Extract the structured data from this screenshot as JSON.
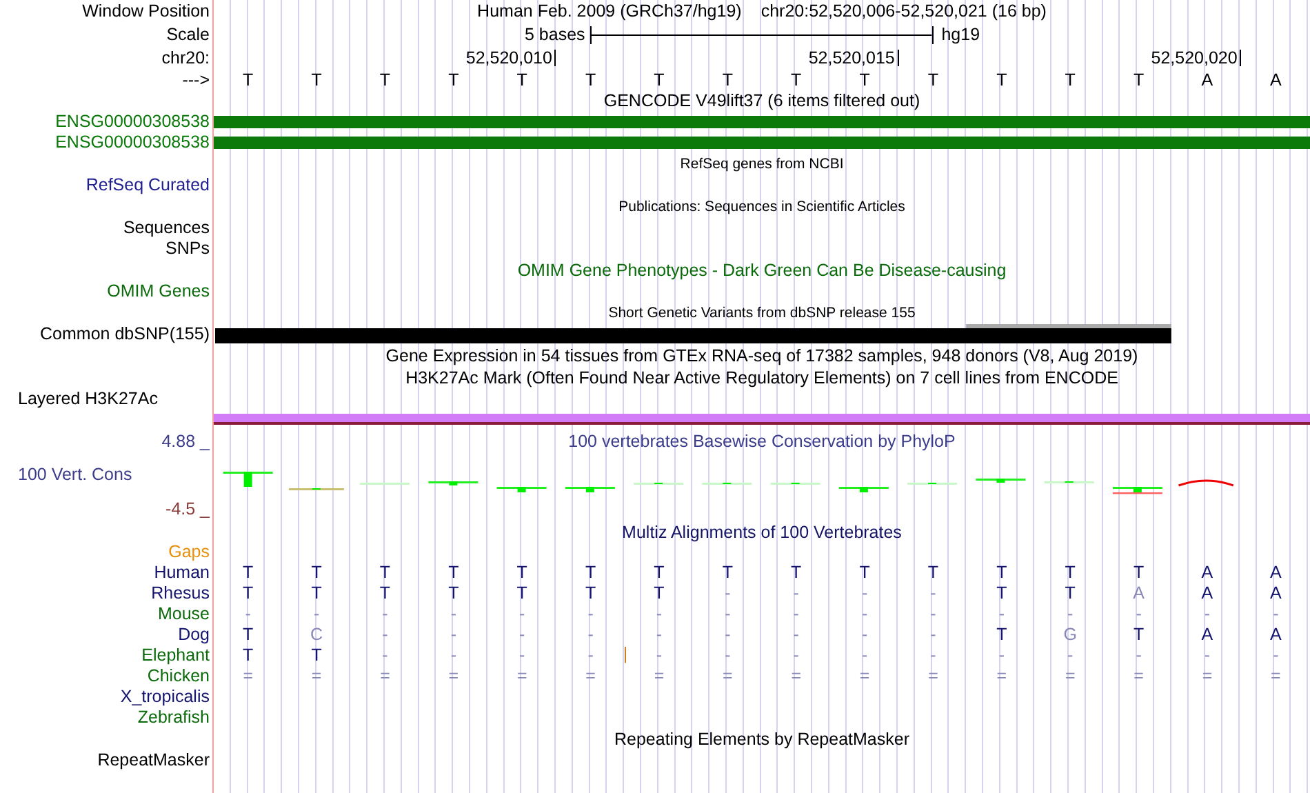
{
  "header": {
    "window_position": {
      "label": "Window Position",
      "assembly": "Human Feb. 2009 (GRCh37/hg19)",
      "range": "chr20:52,520,006-52,520,021 (16 bp)"
    },
    "scale": {
      "label": "Scale",
      "length": "5 bases",
      "assembly": "hg19"
    },
    "ruler": {
      "label": "chr20:",
      "ticks": [
        "52,520,010",
        "52,520,015",
        "52,520,020"
      ]
    },
    "sequence": {
      "label": "--->",
      "bases": [
        "T",
        "T",
        "T",
        "T",
        "T",
        "T",
        "T",
        "T",
        "T",
        "T",
        "T",
        "T",
        "T",
        "T",
        "A",
        "A"
      ]
    }
  },
  "tracks": [
    {
      "kind": "genes",
      "title": "GENCODE V49lift37 (6 items filtered out)",
      "items": [
        {
          "label": "ENSG00000308538",
          "color": "#0b7a0b"
        },
        {
          "label": "ENSG00000308538",
          "color": "#0b7a0b"
        }
      ]
    },
    {
      "kind": "empty",
      "title": "RefSeq genes from NCBI",
      "labels": [
        {
          "text": "RefSeq Curated",
          "color": "#202090"
        }
      ]
    },
    {
      "kind": "empty",
      "title": "Publications: Sequences in Scientific Articles",
      "labels": [
        {
          "text": "Sequences",
          "color": "#000000"
        },
        {
          "text": "SNPs",
          "color": "#000000"
        }
      ]
    },
    {
      "kind": "named",
      "title": "OMIM Gene Phenotypes - Dark Green Can Be Disease-causing",
      "color": "#0b6b0b",
      "labels": [
        {
          "text": "OMIM Genes",
          "color": "#0b6b0b"
        }
      ]
    },
    {
      "kind": "variants",
      "title": "Short Genetic Variants from dbSNP release 155",
      "label": "Common dbSNP(155)"
    },
    {
      "kind": "title",
      "title": "Gene Expression in 54 tissues from GTEx RNA-seq of 17382 samples, 948 donors (V8, Aug 2019)"
    },
    {
      "kind": "signal",
      "title": "H3K27Ac Mark (Often Found Near Active Regulatory Elements) on 7 cell lines from ENCODE",
      "label": "Layered H3K27Ac"
    },
    {
      "kind": "wiggle",
      "title": "100 vertebrates Basewise Conservation by PhyloP",
      "label": "100 Vert. Cons",
      "max": "4.88 _",
      "min": "-4.5 _",
      "color": "#3c3c8c"
    },
    {
      "kind": "alignment",
      "title": "Multiz Alignments of 100 Vertebrates",
      "color": "#141464",
      "species": [
        {
          "name": "Gaps",
          "color": "#e8900c"
        },
        {
          "name": "Human",
          "color": "#14146e",
          "bases": [
            {
              "b": "T",
              "match": true
            },
            {
              "b": "T",
              "match": true
            },
            {
              "b": "T",
              "match": true
            },
            {
              "b": "T",
              "match": true
            },
            {
              "b": "T",
              "match": true
            },
            {
              "b": "T",
              "match": true
            },
            {
              "b": "T",
              "match": true
            },
            {
              "b": "T",
              "match": true
            },
            {
              "b": "T",
              "match": true
            },
            {
              "b": "T",
              "match": true
            },
            {
              "b": "T",
              "match": true
            },
            {
              "b": "T",
              "match": true
            },
            {
              "b": "T",
              "match": true
            },
            {
              "b": "T",
              "match": true
            },
            {
              "b": "A",
              "match": true
            },
            {
              "b": "A",
              "match": true
            }
          ]
        },
        {
          "name": "Rhesus",
          "color": "#14146e",
          "bases": [
            {
              "b": "T",
              "match": true
            },
            {
              "b": "T",
              "match": true
            },
            {
              "b": "T",
              "match": true
            },
            {
              "b": "T",
              "match": true
            },
            {
              "b": "T",
              "match": true
            },
            {
              "b": "T",
              "match": true
            },
            {
              "b": "T",
              "match": true
            },
            {
              "b": "-",
              "match": false
            },
            {
              "b": "-",
              "match": false
            },
            {
              "b": "-",
              "match": false
            },
            {
              "b": "-",
              "match": false
            },
            {
              "b": "T",
              "match": true
            },
            {
              "b": "T",
              "match": true
            },
            {
              "b": "A",
              "match": false
            },
            {
              "b": "A",
              "match": true
            },
            {
              "b": "A",
              "match": true
            }
          ]
        },
        {
          "name": "Mouse",
          "color": "#0b6b0b",
          "bases": [
            {
              "b": "-",
              "match": false
            },
            {
              "b": "-",
              "match": false
            },
            {
              "b": "-",
              "match": false
            },
            {
              "b": "-",
              "match": false
            },
            {
              "b": "-",
              "match": false
            },
            {
              "b": "-",
              "match": false
            },
            {
              "b": "-",
              "match": false
            },
            {
              "b": "-",
              "match": false
            },
            {
              "b": "-",
              "match": false
            },
            {
              "b": "-",
              "match": false
            },
            {
              "b": "-",
              "match": false
            },
            {
              "b": "-",
              "match": false
            },
            {
              "b": "-",
              "match": false
            },
            {
              "b": "-",
              "match": false
            },
            {
              "b": "-",
              "match": false
            },
            {
              "b": "-",
              "match": false
            }
          ]
        },
        {
          "name": "Dog",
          "color": "#14146e",
          "bases": [
            {
              "b": "T",
              "match": true
            },
            {
              "b": "C",
              "match": false
            },
            {
              "b": "-",
              "match": false
            },
            {
              "b": "-",
              "match": false
            },
            {
              "b": "-",
              "match": false
            },
            {
              "b": "-",
              "match": false
            },
            {
              "b": "-",
              "match": false
            },
            {
              "b": "-",
              "match": false
            },
            {
              "b": "-",
              "match": false
            },
            {
              "b": "-",
              "match": false
            },
            {
              "b": "-",
              "match": false
            },
            {
              "b": "T",
              "match": true
            },
            {
              "b": "G",
              "match": false
            },
            {
              "b": "T",
              "match": true
            },
            {
              "b": "A",
              "match": true
            },
            {
              "b": "A",
              "match": true
            }
          ]
        },
        {
          "name": "Elephant",
          "color": "#0b6b0b",
          "bases": [
            {
              "b": "T",
              "match": true
            },
            {
              "b": "T",
              "match": true
            },
            {
              "b": "-",
              "match": false
            },
            {
              "b": "-",
              "match": false
            },
            {
              "b": "-",
              "match": false
            },
            {
              "b": "-",
              "match": false,
              "insertion": "|"
            },
            {
              "b": "-",
              "match": false
            },
            {
              "b": "-",
              "match": false
            },
            {
              "b": "-",
              "match": false
            },
            {
              "b": "-",
              "match": false
            },
            {
              "b": "-",
              "match": false
            },
            {
              "b": "-",
              "match": false
            },
            {
              "b": "-",
              "match": false
            },
            {
              "b": "-",
              "match": false
            },
            {
              "b": "-",
              "match": false
            },
            {
              "b": "-",
              "match": false
            }
          ]
        },
        {
          "name": "Chicken",
          "color": "#0b6b0b",
          "bases": [
            {
              "b": "=",
              "match": false
            },
            {
              "b": "=",
              "match": false
            },
            {
              "b": "=",
              "match": false
            },
            {
              "b": "=",
              "match": false
            },
            {
              "b": "=",
              "match": false
            },
            {
              "b": "=",
              "match": false
            },
            {
              "b": "=",
              "match": false
            },
            {
              "b": "=",
              "match": false
            },
            {
              "b": "=",
              "match": false
            },
            {
              "b": "=",
              "match": false
            },
            {
              "b": "=",
              "match": false
            },
            {
              "b": "=",
              "match": false
            },
            {
              "b": "=",
              "match": false
            },
            {
              "b": "=",
              "match": false
            },
            {
              "b": "=",
              "match": false
            },
            {
              "b": "=",
              "match": false
            }
          ]
        },
        {
          "name": "X_tropicalis",
          "color": "#14146e"
        },
        {
          "name": "Zebrafish",
          "color": "#0b6b0b"
        }
      ]
    },
    {
      "kind": "named",
      "title": "Repeating Elements by RepeatMasker",
      "labels": [
        {
          "text": "RepeatMasker",
          "color": "#000000"
        }
      ]
    }
  ]
}
